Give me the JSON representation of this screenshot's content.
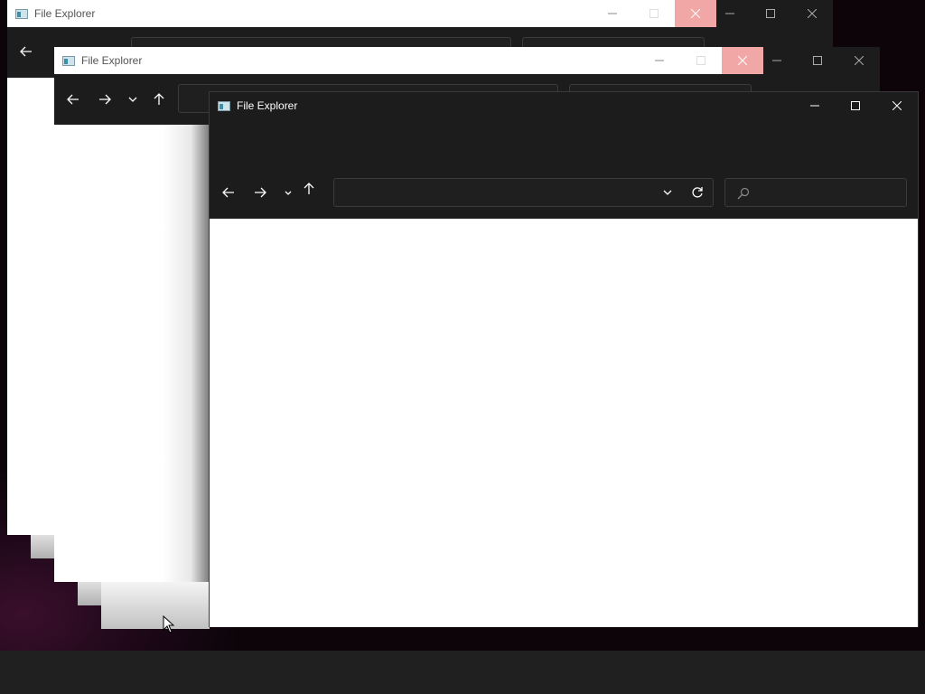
{
  "windows": [
    {
      "title": "File Explorer",
      "state": "background"
    },
    {
      "title": "File Explorer",
      "state": "background"
    },
    {
      "title": "File Explorer",
      "state": "active",
      "caption_buttons": [
        "minimize-icon",
        "maximize-icon",
        "close-icon"
      ],
      "nav_buttons": [
        "back-arrow-icon",
        "forward-arrow-icon",
        "recent-chevron-icon",
        "up-arrow-icon"
      ],
      "address_bar": {
        "value": "",
        "placeholder": ""
      },
      "search_box": {
        "value": "",
        "placeholder": ""
      },
      "address_actions": [
        "dropdown-chevron-icon",
        "refresh-icon"
      ]
    }
  ],
  "colors": {
    "titlebar_dark": "#1c1c1c",
    "content": "#ffffff",
    "close_hover": "#f1a7a5",
    "taskbar": "#202020"
  }
}
